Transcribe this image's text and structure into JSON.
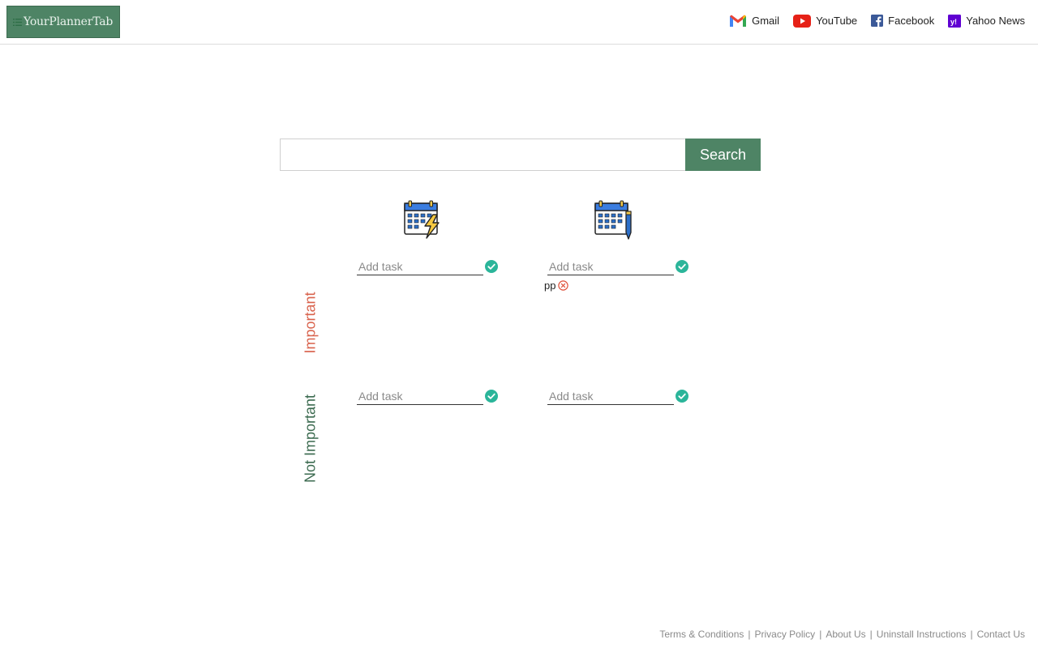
{
  "header": {
    "logo_text": "YourPlannerTab",
    "quicklinks": [
      {
        "label": "Gmail",
        "icon": "gmail-icon"
      },
      {
        "label": "YouTube",
        "icon": "youtube-icon"
      },
      {
        "label": "Facebook",
        "icon": "facebook-icon"
      },
      {
        "label": "Yahoo News",
        "icon": "yahoo-news-icon"
      }
    ]
  },
  "search": {
    "value": "",
    "placeholder": "",
    "button_label": "Search"
  },
  "matrix": {
    "columns": [
      {
        "icon": "calendar-lightning-icon"
      },
      {
        "icon": "calendar-pencil-icon"
      }
    ],
    "rows": [
      {
        "label": "Important"
      },
      {
        "label": "Not Important"
      }
    ],
    "quadrants": [
      {
        "input_placeholder": "Add task",
        "tasks": []
      },
      {
        "input_placeholder": "Add task",
        "tasks": [
          {
            "text": "pp"
          }
        ]
      },
      {
        "input_placeholder": "Add task",
        "tasks": []
      },
      {
        "input_placeholder": "Add task",
        "tasks": []
      }
    ]
  },
  "footer": {
    "links": [
      "Terms & Conditions",
      "Privacy Policy",
      "About Us",
      "Uninstall Instructions",
      "Contact Us"
    ]
  },
  "colors": {
    "brand_green": "#4e8465",
    "important_red": "#d9634d",
    "not_important_green": "#3b6a4f",
    "check_teal": "#2bb59a",
    "remove_red": "#e0533c"
  }
}
